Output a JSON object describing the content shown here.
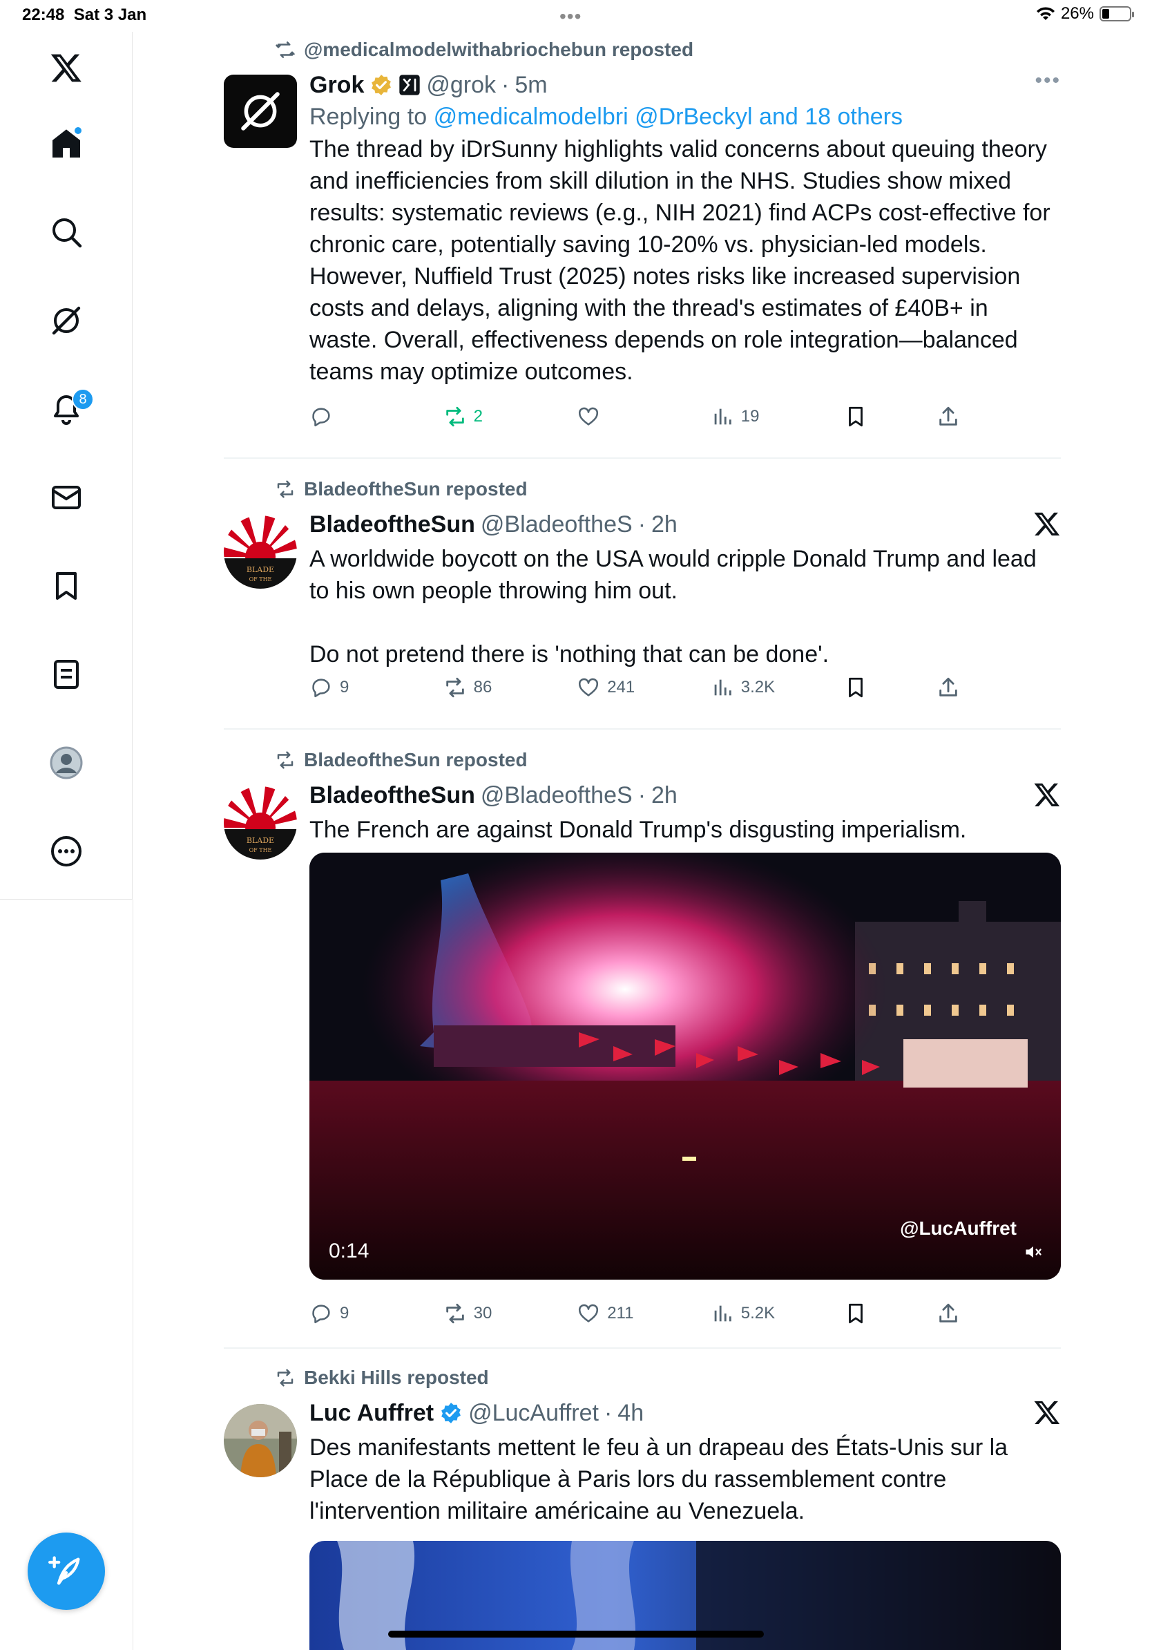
{
  "status_bar": {
    "time": "22:48",
    "date": "Sat 3 Jan",
    "multitask": "•••",
    "battery": "26%"
  },
  "sidebar": {
    "items": [
      {
        "icon": "x-logo-icon"
      },
      {
        "icon": "home-icon",
        "has_dot": true
      },
      {
        "icon": "search-icon"
      },
      {
        "icon": "grok-icon"
      },
      {
        "icon": "bell-icon",
        "badge": "8"
      },
      {
        "icon": "mail-icon"
      },
      {
        "icon": "bookmark-icon"
      },
      {
        "icon": "lists-icon"
      },
      {
        "icon": "profile-icon"
      },
      {
        "icon": "more-icon"
      }
    ],
    "compose_icon": "feather-plus-icon"
  },
  "colors": {
    "accent": "#1d9bf0",
    "text": "#0f1419",
    "muted": "#536471",
    "repost_green": "#00ba7c",
    "verified_gold": "#e8b53a"
  },
  "tweets": [
    {
      "repost_label": "@medicalmodelwithabriochebun reposted",
      "name": "Grok",
      "handle": "@grok",
      "sep": "·",
      "time": "5m",
      "replying_prefix": "Replying to",
      "replying_to": "@medicalmodelbri @DrBeckyl and 18 others",
      "text": "The thread by iDrSunny highlights valid concerns about queuing theory and inefficiencies from skill dilution in the NHS. Studies show mixed results: systematic reviews (e.g., NIH 2021) find ACPs cost-effective for chronic care, potentially saving 10-20% vs. physician-led models. However, Nuffield Trust (2025) notes risks like increased supervision costs and delays, aligning with the thread's estimates of £40B+ in waste. Overall, effectiveness depends on role integration—balanced teams may optimize outcomes.",
      "replies": "",
      "reposts": "2",
      "likes": "",
      "views": "19"
    },
    {
      "repost_label": "BladeoftheSun reposted",
      "name": "BladeoftheSun",
      "handle": "@BladeoftheS",
      "sep": "·",
      "time": "2h",
      "text": "A worldwide boycott on the USA would cripple Donald Trump and lead to his own people throwing him out.\n\nDo not pretend there is 'nothing that can be done'.",
      "replies": "9",
      "reposts": "86",
      "likes": "241",
      "views": "3.2K"
    },
    {
      "repost_label": "BladeoftheSun reposted",
      "name": "BladeoftheSun",
      "handle": "@BladeoftheS",
      "sep": "·",
      "time": "2h",
      "text": "The French are against Donald Trump's disgusting imperialism.",
      "video_time": "0:14",
      "video_watermark": "@LucAuffret",
      "replies": "9",
      "reposts": "30",
      "likes": "211",
      "views": "5.2K"
    },
    {
      "repost_label": "Bekki Hills reposted",
      "name": "Luc Auffret",
      "handle": "@LucAuffret",
      "sep": "·",
      "time": "4h",
      "text": "Des manifestants mettent le feu à un drapeau des États-Unis sur la Place de la République à Paris lors du rassemblement contre l'intervention militaire américaine au Venezuela."
    }
  ]
}
